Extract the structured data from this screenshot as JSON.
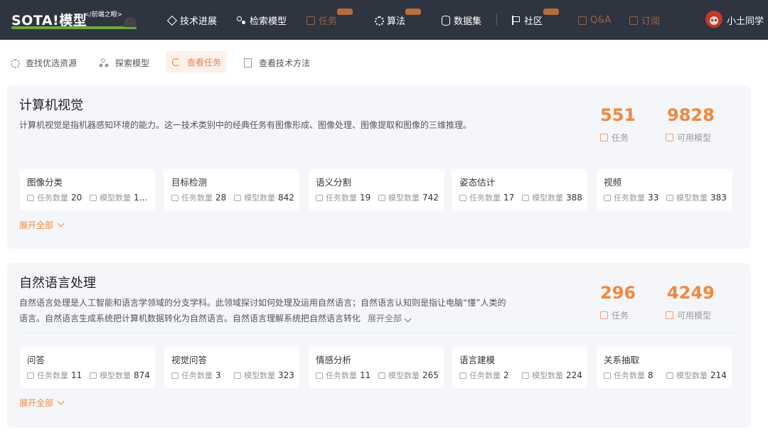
{
  "header": {
    "logo_text": "SOTA!模型",
    "logo_tagline": "</前端之眼>",
    "nav": [
      {
        "label": "技术进展",
        "icon": "diamond-icon"
      },
      {
        "label": "检索模型",
        "icon": "nodes-icon"
      },
      {
        "label": "任务",
        "icon": "square-icon"
      },
      {
        "label": "算法",
        "icon": "gear-icon"
      },
      {
        "label": "数据集",
        "icon": "database-icon"
      },
      {
        "label": "社区",
        "icon": "flag-icon"
      },
      {
        "label": "Q&A",
        "icon": "square-icon"
      },
      {
        "label": "订阅",
        "icon": "square-icon"
      }
    ],
    "user": {
      "name": "小土同学"
    }
  },
  "subnav": [
    {
      "label": "查找优选资源",
      "icon": "gear-icon"
    },
    {
      "label": "探索模型",
      "icon": "nodes-icon"
    },
    {
      "label": "查看任务",
      "icon": "cycle-icon",
      "active": true
    },
    {
      "label": "查看技术方法",
      "icon": "document-icon"
    }
  ],
  "sections": [
    {
      "title": "计算机视觉",
      "description": "计算机视觉是指机器感知环境的能力。这一技术类别中的经典任务有图像形成、图像处理、图像提取和图像的三维推理。",
      "stats": {
        "tasks": "551",
        "tasks_label": "任务",
        "models": "9828",
        "models_label": "可用模型"
      },
      "cards": [
        {
          "title": "图像分类",
          "task_label": "任务数量",
          "task_count": "20",
          "model_label": "模型数量",
          "model_count": "1…"
        },
        {
          "title": "目标检测",
          "task_label": "任务数量",
          "task_count": "28",
          "model_label": "模型数量",
          "model_count": "842"
        },
        {
          "title": "语义分割",
          "task_label": "任务数量",
          "task_count": "19",
          "model_label": "模型数量",
          "model_count": "742"
        },
        {
          "title": "姿态估计",
          "task_label": "任务数量",
          "task_count": "17",
          "model_label": "模型数量",
          "model_count": "388"
        },
        {
          "title": "视频",
          "task_label": "任务数量",
          "task_count": "33",
          "model_label": "模型数量",
          "model_count": "383"
        }
      ],
      "expand_label": "展开全部"
    },
    {
      "title": "自然语言处理",
      "description": "自然语言处理是人工智能和语言学领域的分支学科。此领域探讨如何处理及运用自然语言；自然语言认知则是指让电脑“懂”人类的语言。自然语言生成系统把计算机数据转化为自然语言。自然语言理解系统把自然语言转化",
      "desc_expand": "展开全部",
      "stats": {
        "tasks": "296",
        "tasks_label": "任务",
        "models": "4249",
        "models_label": "可用模型"
      },
      "cards": [
        {
          "title": "问答",
          "task_label": "任务数量",
          "task_count": "11",
          "model_label": "模型数量",
          "model_count": "874"
        },
        {
          "title": "视觉问答",
          "task_label": "任务数量",
          "task_count": "3",
          "model_label": "模型数量",
          "model_count": "323"
        },
        {
          "title": "情感分析",
          "task_label": "任务数量",
          "task_count": "11",
          "model_label": "模型数量",
          "model_count": "265"
        },
        {
          "title": "语言建模",
          "task_label": "任务数量",
          "task_count": "2",
          "model_label": "模型数量",
          "model_count": "224"
        },
        {
          "title": "关系抽取",
          "task_label": "任务数量",
          "task_count": "8",
          "model_label": "模型数量",
          "model_count": "214"
        }
      ],
      "expand_label": "展开全部"
    }
  ]
}
